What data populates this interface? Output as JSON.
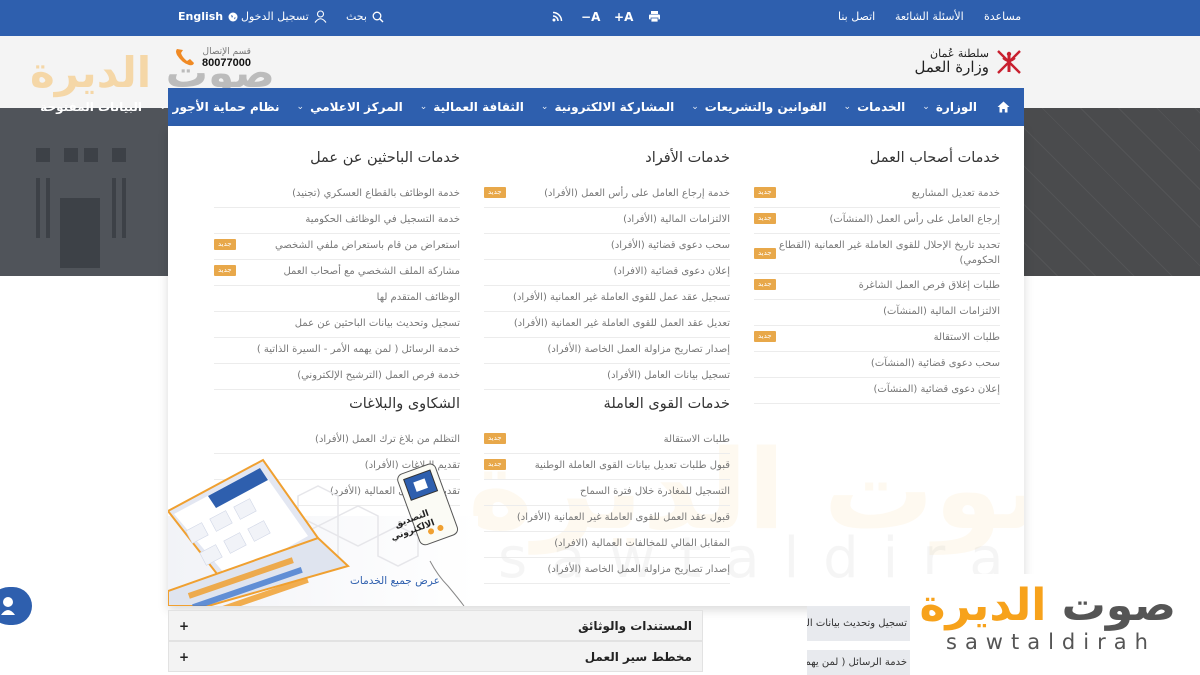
{
  "topbar": {
    "language": "English",
    "login": "تسجيل الدخول",
    "search": "بحث",
    "font_decrease": "A−",
    "font_increase": "A+",
    "help": "مساعدة",
    "faq": "الأسئلة الشائعة",
    "contact": "اتصل بنا"
  },
  "header": {
    "logo_line1": "سلطنة عُمان",
    "logo_line2": "وزارة العمل",
    "call_label": "قسم الإتصال",
    "call_number": "80077000"
  },
  "nav": {
    "items": [
      {
        "label": "الوزارة",
        "dropdown": true
      },
      {
        "label": "الخدمات",
        "dropdown": true
      },
      {
        "label": "القوانين والتشريعات",
        "dropdown": true
      },
      {
        "label": "المشاركة الالكترونية",
        "dropdown": true
      },
      {
        "label": "الثقافة العمالية",
        "dropdown": true
      },
      {
        "label": "المركز الاعلامي",
        "dropdown": true
      },
      {
        "label": "نظام حماية الأجور",
        "dropdown": true
      },
      {
        "label": "البيانات المفتوحة",
        "dropdown": false
      }
    ]
  },
  "mega": {
    "badge_label": "جديد",
    "employers": {
      "title": "خدمات أصحاب العمل",
      "items": [
        {
          "label": "خدمة تعديل المشاريع",
          "new": true
        },
        {
          "label": "إرجاع العامل على رأس العمل (المنشآت)",
          "new": true
        },
        {
          "label": "تحديد تاريخ الإحلال للقوى العاملة غير العمانية (القطاع الحكومي)",
          "new": true
        },
        {
          "label": "طلبات إغلاق فرص العمل الشاغرة",
          "new": true
        },
        {
          "label": "الالتزامات المالية (المنشآت)",
          "new": false
        },
        {
          "label": "طلبات الاستقالة",
          "new": true
        },
        {
          "label": "سحب دعوى قضائية (المنشآت)",
          "new": false
        },
        {
          "label": "إعلان دعوى قضائية (المنشآت)",
          "new": false
        }
      ]
    },
    "individuals": {
      "title": "خدمات الأفراد",
      "items": [
        {
          "label": "خدمة إرجاع العامل على رأس العمل (الأفراد)",
          "new": true
        },
        {
          "label": "الالتزامات المالية (الأفراد)",
          "new": false
        },
        {
          "label": "سحب دعوى قضائية (الأفراد)",
          "new": false
        },
        {
          "label": "إعلان دعوى قضائية (الافراد)",
          "new": false
        },
        {
          "label": "تسجيل عقد عمل للقوى العاملة غير العمانية (الأفراد)",
          "new": false
        },
        {
          "label": "تعديل عقد العمل للقوى العاملة غير العمانية (الأفراد)",
          "new": false
        },
        {
          "label": "إصدار تصاريح مزاولة العمل الخاصة (الأفراد)",
          "new": false
        },
        {
          "label": "تسجيل بيانات العامل (الأفراد)",
          "new": false
        }
      ]
    },
    "jobseekers": {
      "title": "خدمات الباحثين عن عمل",
      "items": [
        {
          "label": "خدمة الوظائف بالقطاع العسكري (تجنيد)",
          "new": false
        },
        {
          "label": "خدمة التسجيل في الوظائف الحكومية",
          "new": false
        },
        {
          "label": "استعراض من قام باستعراض ملفي الشخصي",
          "new": true
        },
        {
          "label": "مشاركة الملف الشخصي مع أصحاب العمل",
          "new": true
        },
        {
          "label": "الوظائف المتقدم لها",
          "new": false
        },
        {
          "label": "تسجيل وتحديث بيانات الباحثين عن عمل",
          "new": false
        },
        {
          "label": "خدمة الرسائل ( لمن يهمه الأمر - السيرة الذاتية )",
          "new": false
        },
        {
          "label": "خدمة فرص العمل (الترشيح الإلكتروني)",
          "new": false
        }
      ]
    },
    "workforce": {
      "title": "خدمات القوى العاملة",
      "items": [
        {
          "label": "طلبات الاستقالة",
          "new": true
        },
        {
          "label": "قبول طلبات تعديل بيانات القوى العاملة الوطنية",
          "new": true
        },
        {
          "label": "التسجيل للمغادرة خلال فترة السماح",
          "new": false
        },
        {
          "label": "قبول عقد العمل للقوى العاملة غير العمانية (الأفراد)",
          "new": false
        },
        {
          "label": "المقابل المالي للمخالفات العمالية (الافراد)",
          "new": false
        },
        {
          "label": "إصدار تصاريح مزاولة العمل الخاصة (الأفراد)",
          "new": false
        }
      ]
    },
    "complaints": {
      "title": "الشكاوى والبلاغات",
      "items": [
        {
          "label": "التظلم من بلاغ ترك العمل (الأفراد)",
          "new": false
        },
        {
          "label": "تقديم البلاغات (الأفراد)",
          "new": false
        },
        {
          "label": "تقديم الشكاوى العمالية (الأفرد)",
          "new": false
        }
      ]
    },
    "illustration_caption": "التصديق الالكتروني",
    "view_all": "عرض جميع الخدمات"
  },
  "content": {
    "accordion": [
      {
        "label": "المستندات والوثائق",
        "icon": "+"
      },
      {
        "label": "مخطط سير العمل",
        "icon": "+"
      }
    ],
    "side_links": [
      "تسجيل وتحديث بيانات الباحثين عن عمل",
      "خدمة الرسائل ( لمن يهمه الأمر -"
    ]
  },
  "watermark": {
    "ar_part1": "صوت",
    "ar_part2": "الديرة",
    "latin": "sawtaldirah"
  },
  "colors": {
    "brand_blue": "#2e5fae",
    "badge_orange": "#e8a84a",
    "watermark_orange": "#f7a21b"
  }
}
